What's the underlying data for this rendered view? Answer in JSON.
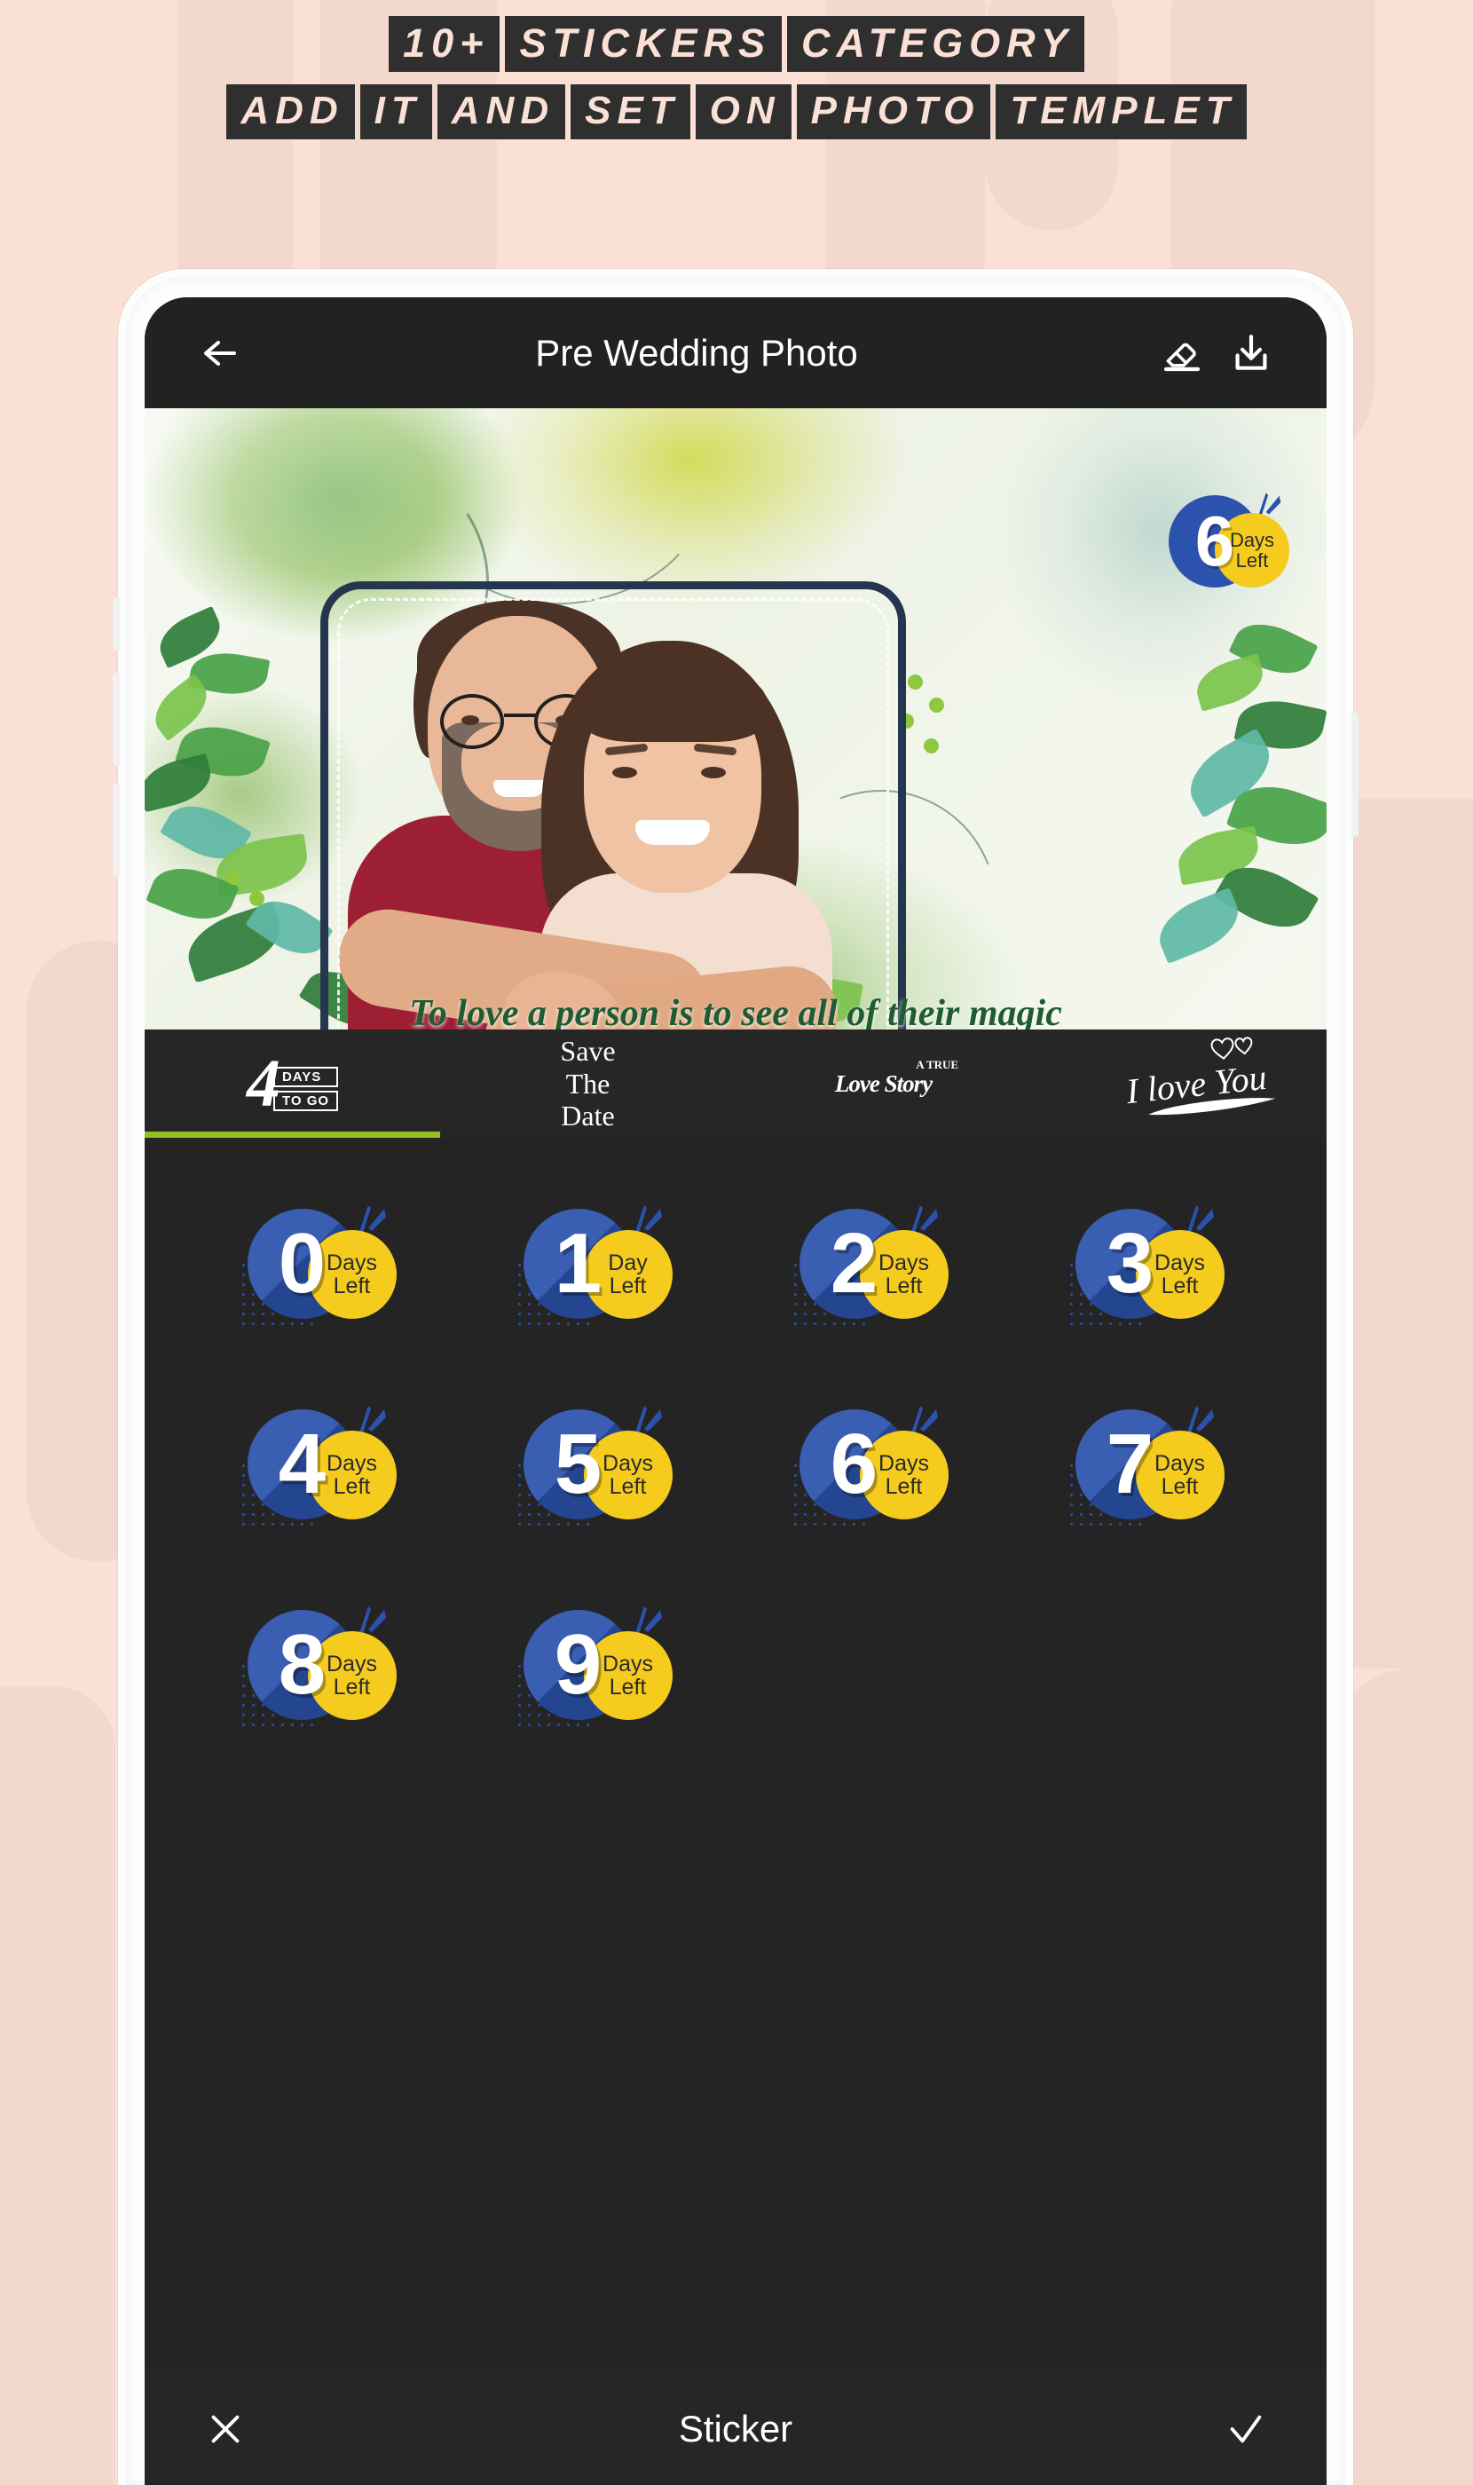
{
  "promo": {
    "line1_words": [
      "10+",
      "STICKERS",
      "CATEGORY"
    ],
    "line2_words": [
      "ADD",
      "IT",
      "AND",
      "SET",
      "ON",
      "PHOTO",
      "TEMPLET"
    ],
    "bg_color": "#fbe0d5",
    "text_color": "#2f2f2f"
  },
  "appbar": {
    "title": "Pre Wedding Photo",
    "back_icon": "arrow-left-icon",
    "eraser_icon": "eraser-icon",
    "download_icon": "download-icon"
  },
  "canvas": {
    "quote": "To love a person is to see all of their magic",
    "applied_sticker": {
      "number": "6",
      "line1": "Days",
      "line2": "Left"
    },
    "frame_color": "#25364f"
  },
  "tabs": {
    "active_index": 0,
    "active_color": "#95c11f",
    "items": [
      {
        "name": "4-days-to-go",
        "number": "4",
        "ribbon1": "DAYS",
        "ribbon2": "TO GO"
      },
      {
        "name": "save-the-date",
        "line1": "Save",
        "line2": "The",
        "line3": "Date"
      },
      {
        "name": "a-true-love-story",
        "sup": "A TRUE",
        "label": "Love Story"
      },
      {
        "name": "i-love-you",
        "label": "I love You"
      }
    ]
  },
  "stickers": {
    "accent_blue": "#2b52ac",
    "accent_yellow": "#f5cc1e",
    "items": [
      {
        "number": "0",
        "line1": "Days",
        "line2": "Left"
      },
      {
        "number": "1",
        "line1": "Day",
        "line2": "Left"
      },
      {
        "number": "2",
        "line1": "Days",
        "line2": "Left"
      },
      {
        "number": "3",
        "line1": "Days",
        "line2": "Left"
      },
      {
        "number": "4",
        "line1": "Days",
        "line2": "Left"
      },
      {
        "number": "5",
        "line1": "Days",
        "line2": "Left"
      },
      {
        "number": "6",
        "line1": "Days",
        "line2": "Left"
      },
      {
        "number": "7",
        "line1": "Days",
        "line2": "Left"
      },
      {
        "number": "8",
        "line1": "Days",
        "line2": "Left"
      },
      {
        "number": "9",
        "line1": "Days",
        "line2": "Left"
      }
    ]
  },
  "bottombar": {
    "cancel_icon": "close-icon",
    "title": "Sticker",
    "confirm_icon": "check-icon"
  }
}
